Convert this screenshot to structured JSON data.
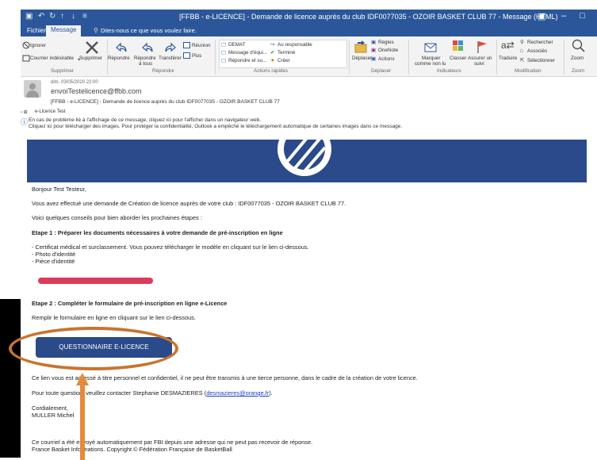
{
  "window": {
    "title": "[FFBB - e-LICENCE] - Demande de licence auprès du club IDF0077035 - OZOIR BASKET CLUB 77 - Message (HTML)",
    "tell_me": "Dites-nous ce que vous voulez faire."
  },
  "tabs": [
    "Fichier",
    "Message"
  ],
  "ribbon": {
    "supprimer": {
      "ignorer": "Ignorer",
      "courrier": "Courrier indésirable",
      "supprimer": "Supprimer",
      "group": "Supprimer"
    },
    "repondre": {
      "repondre": "Répondre",
      "repondre_tous_1": "Répondre",
      "repondre_tous_2": "à tous",
      "transferer": "Transférer",
      "reunion": "Réunion",
      "plus": "Plus",
      "group": "Répondre"
    },
    "actions": {
      "demat": "DEMAT",
      "message_equipe": "Message d'équi...",
      "repondre_su": "Répondre et su...",
      "responsable": "Au responsable",
      "termine": "Terminé",
      "creer": "Créer",
      "group": "Actions rapides"
    },
    "deplacer": {
      "deplacer": "Déplacer",
      "regles": "Règles",
      "onenote": "OneNote",
      "actions": "Actions",
      "group": "Déplacer"
    },
    "indicateurs": {
      "marquer_1": "Marquer",
      "marquer_2": "comme non lu",
      "classer": "Classer",
      "assurer_1": "Assurer un",
      "assurer_2": "suivi",
      "group": "Indicateurs"
    },
    "modification": {
      "traduire": "Traduire",
      "rechercher": "Rechercher",
      "associes": "Associés",
      "selectionner": "Sélectionner",
      "group": "Modification"
    },
    "zoom": {
      "zoom": "Zoom",
      "group": "Zoom"
    }
  },
  "header": {
    "date": "dim. 03/05/2020 22:00",
    "from": "envoiTestelicence@ffbb.com",
    "subject": "[FFBB - e-LICENCE] - Demande de licence auprès du club IDF0077035 - OZOIR BASKET CLUB 77",
    "to": "e-Licence Test",
    "info_line_1": "En cas de problème lié à l'affichage de ce message, cliquez ici pour l'afficher dans un navigateur web.",
    "info_line_2": "Cliquez ici pour télécharger des images. Pour protéger la confidentialité, Outlook a empêché le téléchargement automatique de certaines images dans ce message."
  },
  "body": {
    "greeting": "Bonjour Test Testeur,",
    "line1": "Vous avez effectué une demande de Création de licence auprès de votre club : IDF0077035 - OZOIR BASKET CLUB 77.",
    "line2": "Voici quelques conseils pour bien aborder les prochaines étapes :",
    "etape1": "Etape 1 : Préparer les documents nécessaires à votre demande de pré-inscription en ligne",
    "doc1": "- Certificat médical et surclassement. Vous pouvez télécharger le modèle en cliquant sur le lien ci-dessous.",
    "doc2": "- Photo d'identité",
    "doc3": "- Pièce d'identité",
    "etape2": "Etape 2 : Compléter le formulaire de pré-inscription en ligne e-Licence",
    "remplir": "Remplir le formulaire en ligne en cliquant sur le lien ci-dessous.",
    "button": "QUESTIONNAIRE E-LICENCE",
    "notice": "Ce lien vous est adressé à titre personnel et confidentiel, il ne peut être transmis à une tierce personne, dans le cadre de la création de votre licence.",
    "question_prefix": "Pour toute question, veuillez contacter Stephanie DESMAZIERES (",
    "question_email": "desmazieres@orange.fr",
    "question_suffix": ").",
    "cordialement": "Cordialement,",
    "signature": "MULLER Michel",
    "footer1": "Ce courriel a été envoyé automatiquement par FBI depuis une adresse qui ne peut pas recevoir de réponse.",
    "footer2": "France Basket Informations. Copyright © Fédération Française de BasketBall"
  },
  "colors": {
    "accent": "#2b579a",
    "banner": "#2b4a8c",
    "button": "#2a4a8a",
    "pink": "#dc3b59",
    "annotation": "#c8742e"
  }
}
